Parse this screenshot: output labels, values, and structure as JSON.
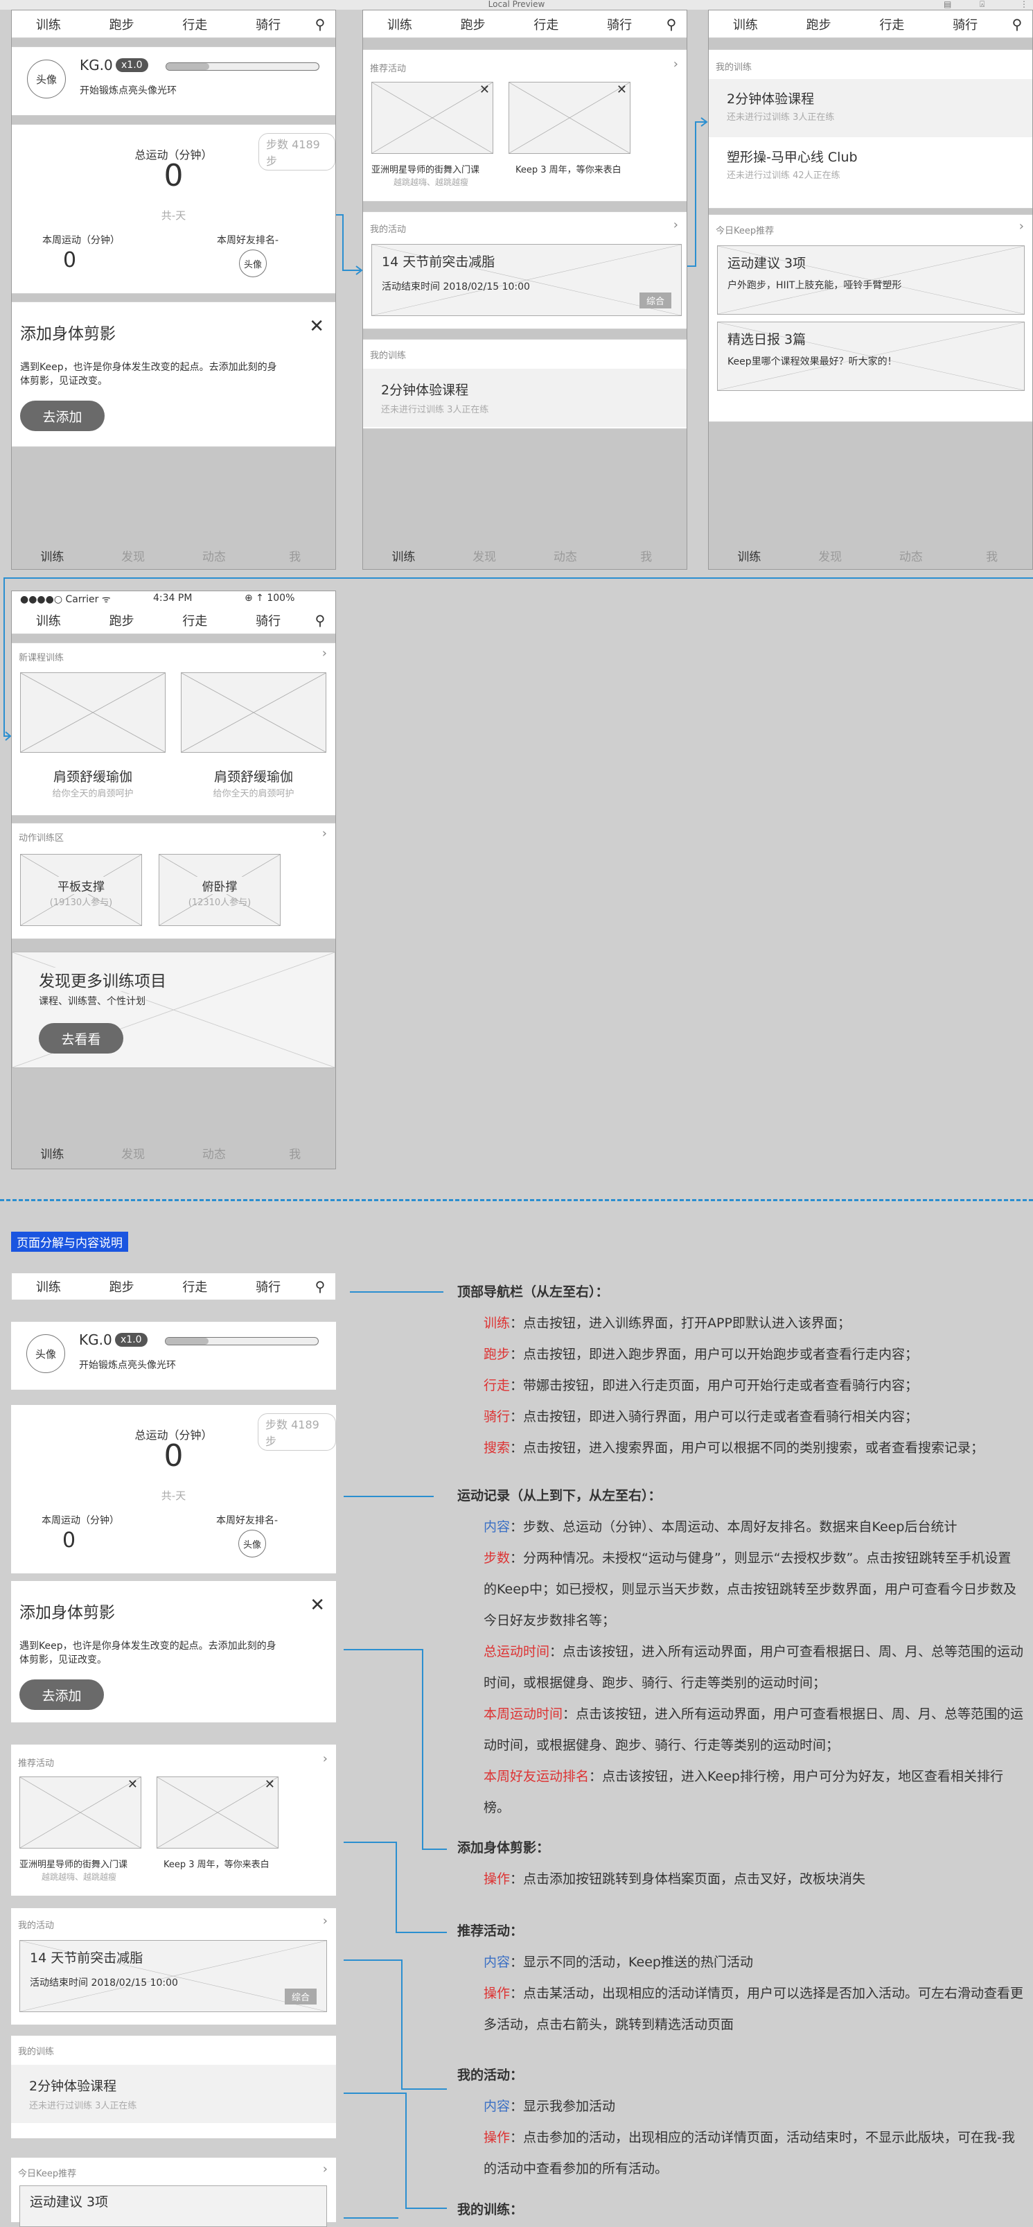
{
  "window": {
    "title": "Local Preview"
  },
  "nav": {
    "tabs": [
      "训练",
      "跑步",
      "行走",
      "骑行"
    ]
  },
  "bottom": {
    "tabs": [
      "训练",
      "发现",
      "动态",
      "我"
    ]
  },
  "status": {
    "carrier": "●●●●○ Carrier ᯤ",
    "time": "4:34 PM",
    "battery": "⊕ ↑ 100%"
  },
  "profile": {
    "avatar": "头像",
    "level": "KG.0",
    "badge": "x1.0",
    "hint": "开始锻炼点亮头像光环"
  },
  "stats": {
    "steps_tag": "步数 4189步",
    "total_label": "总运动（分钟）",
    "total_value": "0",
    "days": "共-天",
    "week_label": "本周运动（分钟）",
    "week_value": "0",
    "rank_label": "本周好友排名-",
    "rank_avatar": "头像"
  },
  "body": {
    "title": "添加身体剪影",
    "desc": "遇到Keep，也许是你身体发生改变的起点。去添加此刻的身体剪影，见证改变。",
    "button": "去添加"
  },
  "recommend": {
    "title": "推荐活动",
    "item1": "亚洲明星导师的街舞入门课",
    "item1_sub": "越跳越嗨、越跳越瘦",
    "item2": "Keep 3 周年，等你来表白"
  },
  "myact": {
    "title": "我的活动",
    "name": "14 天节前突击减脂",
    "date": "活动结束时间 2018/02/15 10:00",
    "tag": "综合"
  },
  "mytrain": {
    "title": "我的训练",
    "c1": "2分钟体验课程",
    "c1_sub": "还未进行过训练 3人正在练",
    "c2": "塑形操-马甲心线 Club",
    "c2_sub": "还未进行过训练 42人正在练"
  },
  "today": {
    "title": "今日Keep推荐",
    "i1": "运动建议   3项",
    "i1_sub": "户外跑步，HIIT上肢充能，哑铃手臂塑形",
    "i2": "精选日报   3篇",
    "i2_sub": "Keep里哪个课程效果最好？听大家的！"
  },
  "newcourse": {
    "title": "新课程训练",
    "n1": "肩颈舒缓瑜伽",
    "n1_sub": "给你全天的肩颈呵护",
    "n2": "肩颈舒缓瑜伽",
    "n2_sub": "给你全天的肩颈呵护"
  },
  "motion": {
    "title": "动作训练区",
    "m1": "平板支撑",
    "m1_sub": "(19130人参与)",
    "m2": "俯卧撑",
    "m2_sub": "(12310人参与)"
  },
  "discover": {
    "title": "发现更多训练项目",
    "sub": "课程、训练营、个性计划",
    "button": "去看看"
  },
  "section_tag": "页面分解与内容说明",
  "annotations": {
    "nav_head": "顶部导航栏（从左至右）：",
    "nav_items": [
      {
        "k": "训练",
        "v": "：点击按钮，进入训练界面，打开APP即默认进入该界面；"
      },
      {
        "k": "跑步",
        "v": "：点击按钮，即进入跑步界面，用户可以开始跑步或者查看行走内容；"
      },
      {
        "k": "行走",
        "v": "：带娜击按钮，即进入行走页面，用户可开始行走或者查看骑行内容；"
      },
      {
        "k": "骑行",
        "v": "：点击按钮，即进入骑行界面，用户可以行走或者查看骑行相关内容；"
      },
      {
        "k": "搜索",
        "v": "：点击按钮，进入搜索界面，用户可以根据不同的类别搜索，或者查看搜索记录；"
      }
    ],
    "rec_head": "运动记录（从上到下，从左至右）：",
    "rec_content_k": "内容",
    "rec_content_v": "：步数、总运动（分钟）、本周运动、本周好友排名。数据来自Keep后台统计",
    "rec_lines": [
      {
        "k": "步数",
        "v": "：分两种情况。未授权“运动与健身”，则显示“去授权步数”。点击按钮跳转至手机设置"
      },
      {
        "k": "",
        "v": "的Keep中；如已授权，则显示当天步数，点击按钮跳转至步数界面，用户可查看今日步数及"
      },
      {
        "k": "",
        "v": "今日好友步数排名等；"
      },
      {
        "k": "总运动时间",
        "v": "：点击该按钮，进入所有运动界面，用户可查看根据日、周、月、总等范围的运动"
      },
      {
        "k": "",
        "v": "时间，或根据健身、跑步、骑行、行走等类别的运动时间；"
      },
      {
        "k": "本周运动时间",
        "v": "：点击该按钮，进入所有运动界面，用户可查看根据日、周、月、总等范围的运"
      },
      {
        "k": "",
        "v": "动时间，或根据健身、跑步、骑行、行走等类别的运动时间；"
      },
      {
        "k": "本周好友运动排名",
        "v": "：点击该按钮，进入Keep排行榜，用户可分为好友，地区查看相关排行"
      },
      {
        "k": "",
        "v": "榜。"
      }
    ],
    "body_head": "添加身体剪影：",
    "body_op_k": "操作",
    "body_op_v": "：点击添加按钮跳转到身体档案页面，点击叉好，改板块消失",
    "recact_head": "推荐活动：",
    "recact_content_k": "内容",
    "recact_content_v": "：显示不同的活动，Keep推送的热门活动",
    "recact_op_k": "操作",
    "recact_op_v": "：点击某活动，出现相应的活动详情页，用户可以选择是否加入活动。可左右滑动查看更",
    "recact_op_v2": "多活动，点击右箭头，跳转到精选活动页面",
    "myact_head": "我的活动：",
    "myact_content_k": "内容",
    "myact_content_v": "：显示我参加活动",
    "myact_op_k": "操作",
    "myact_op_v": "：点击参加的活动，出现相应的活动详情页面，活动结束时，不显示此版块，可在我-我",
    "myact_op_v2": "的活动中查看参加的所有活动。",
    "mytrain_head": "我的训练："
  },
  "colors": {
    "accent_line": "#2b8fd0",
    "red": "#d33333",
    "blue": "#3a6fc4",
    "button": "#6a6a6a"
  }
}
